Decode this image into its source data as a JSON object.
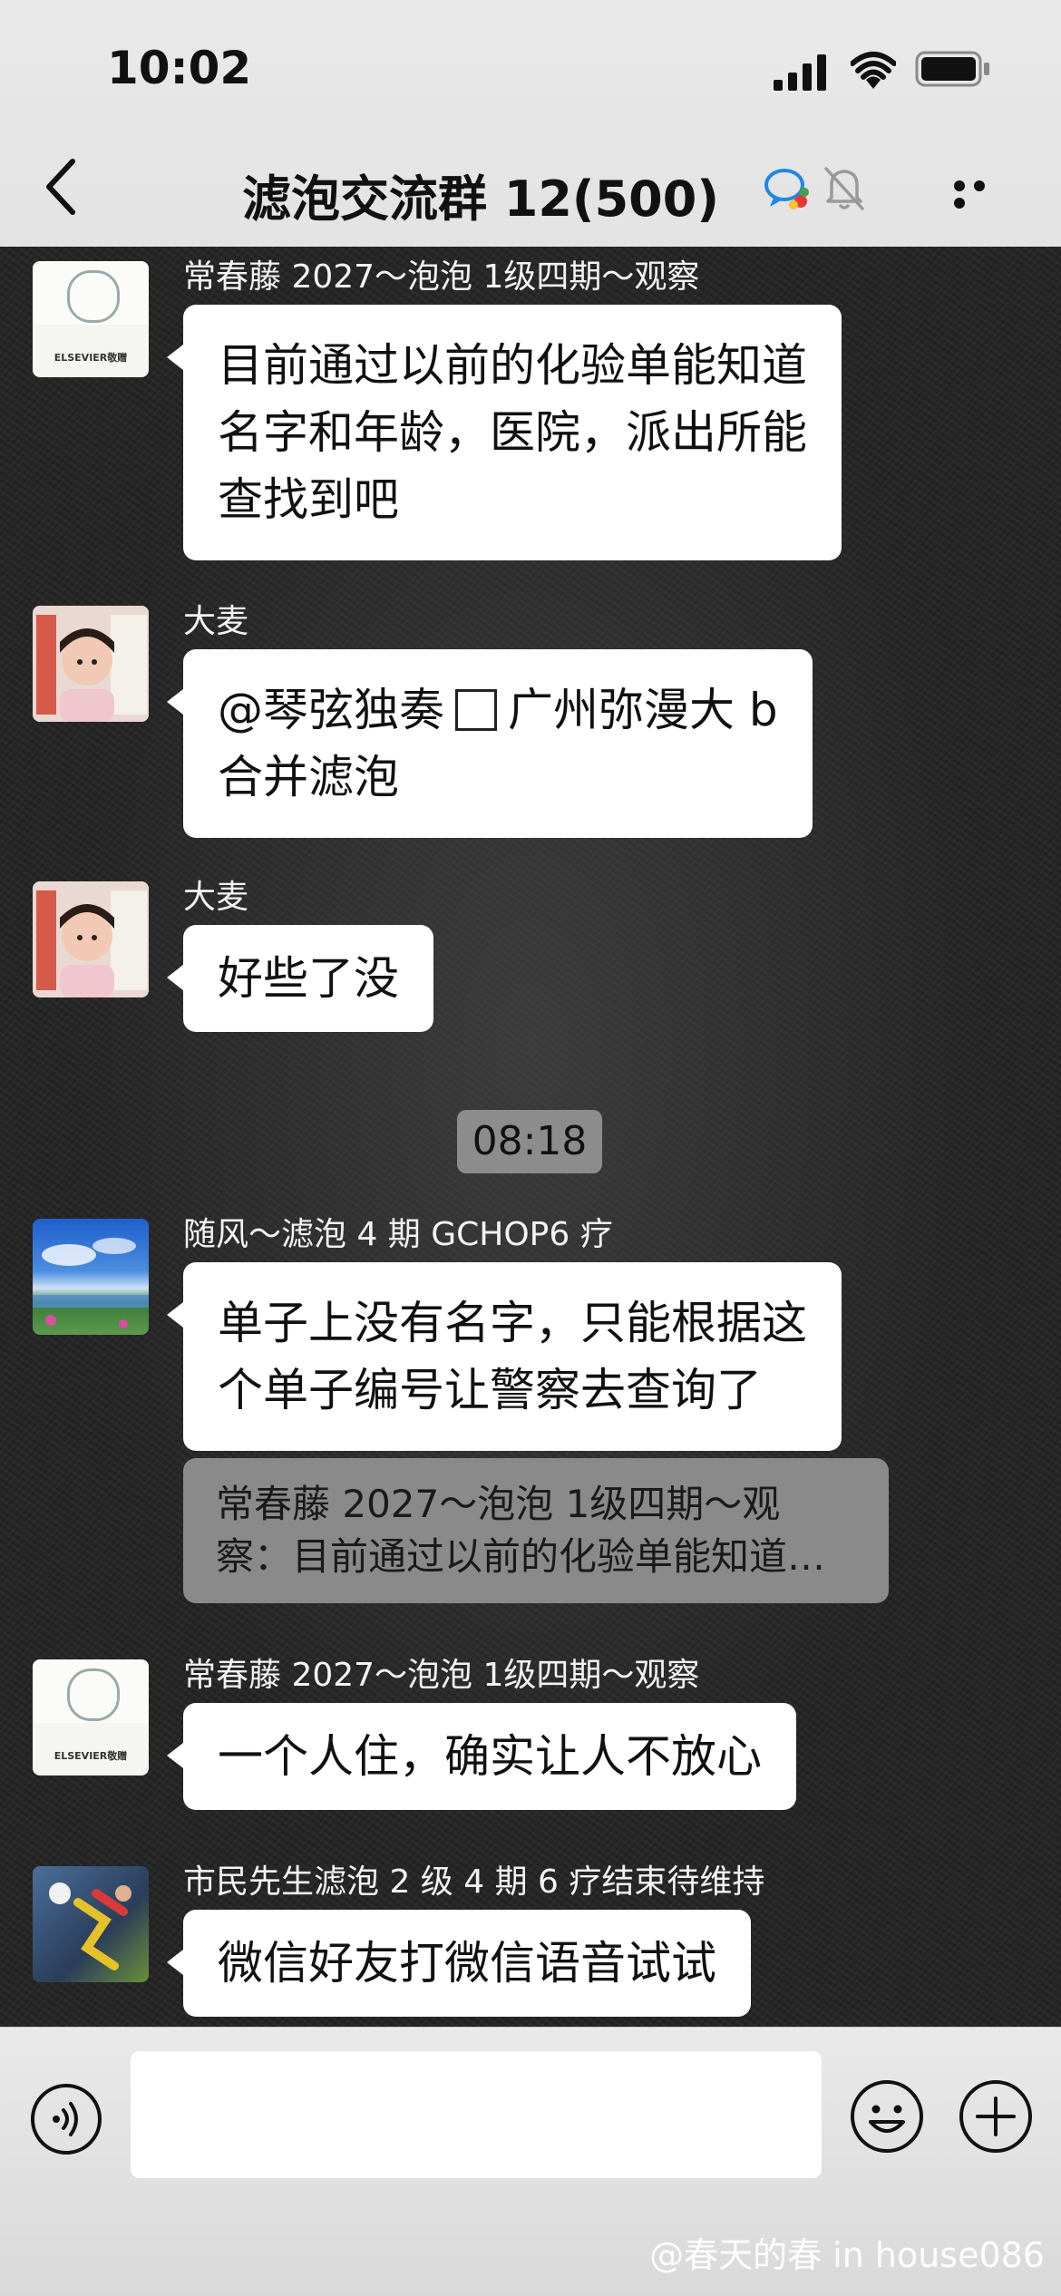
{
  "status_bar": {
    "time": "10:02"
  },
  "nav": {
    "back_icon": "chevron-left-icon",
    "title": "滤泡交流群 12(500)",
    "chat_icon": "group-chat-icon",
    "mute_icon": "bell-muted-icon",
    "more_icon": "more-horizontal-icon"
  },
  "messages": [
    {
      "sender": "常春藤 2027～泡泡 1级四期～观察",
      "avatar": "elsevier-logo-avatar",
      "avatar_text": "ELSEVIER敬赠",
      "lines": [
        "目前通过以前的化验单能知道",
        "名字和年龄，医院，派出所能",
        "查找到吧"
      ]
    },
    {
      "sender": "大麦",
      "avatar": "child-photo-avatar",
      "line1_prefix": "@琴弦独奏",
      "line1_suffix": "广州弥漫大 b",
      "line2": "合并滤泡"
    },
    {
      "sender": "大麦",
      "avatar": "child-photo-avatar",
      "lines": [
        "好些了没"
      ]
    },
    {
      "sender": "随风～滤泡 4 期 GCHOP6 疗",
      "avatar": "landscape-avatar",
      "lines": [
        "单子上没有名字，只能根据这",
        "个单子编号让警察去查询了"
      ],
      "quote": [
        "常春藤 2027～泡泡 1级四期～观",
        "察：目前通过以前的化验单能知道名字和年龄"
      ]
    },
    {
      "sender": "常春藤 2027～泡泡 1级四期～观察",
      "avatar": "elsevier-logo-avatar",
      "avatar_text": "ELSEVIER敬赠",
      "lines": [
        "一个人住，确实让人不放心"
      ]
    },
    {
      "sender": "市民先生滤泡 2 级 4 期 6 疗结束待维持",
      "avatar": "soccer-avatar",
      "lines": [
        "微信好友打微信语音试试"
      ]
    }
  ],
  "timestamp": "08:18",
  "input_bar": {
    "voice_icon": "voice-icon",
    "input_value": "",
    "emoji_icon": "emoji-icon",
    "plus_icon": "plus-icon"
  },
  "watermark": "@春天的春 in house086",
  "colors": {
    "bubble": "#ffffff",
    "quote_bg": "#8a8a8a",
    "chat_bg": "#242424",
    "bar_bg": "#e6e6e6"
  }
}
